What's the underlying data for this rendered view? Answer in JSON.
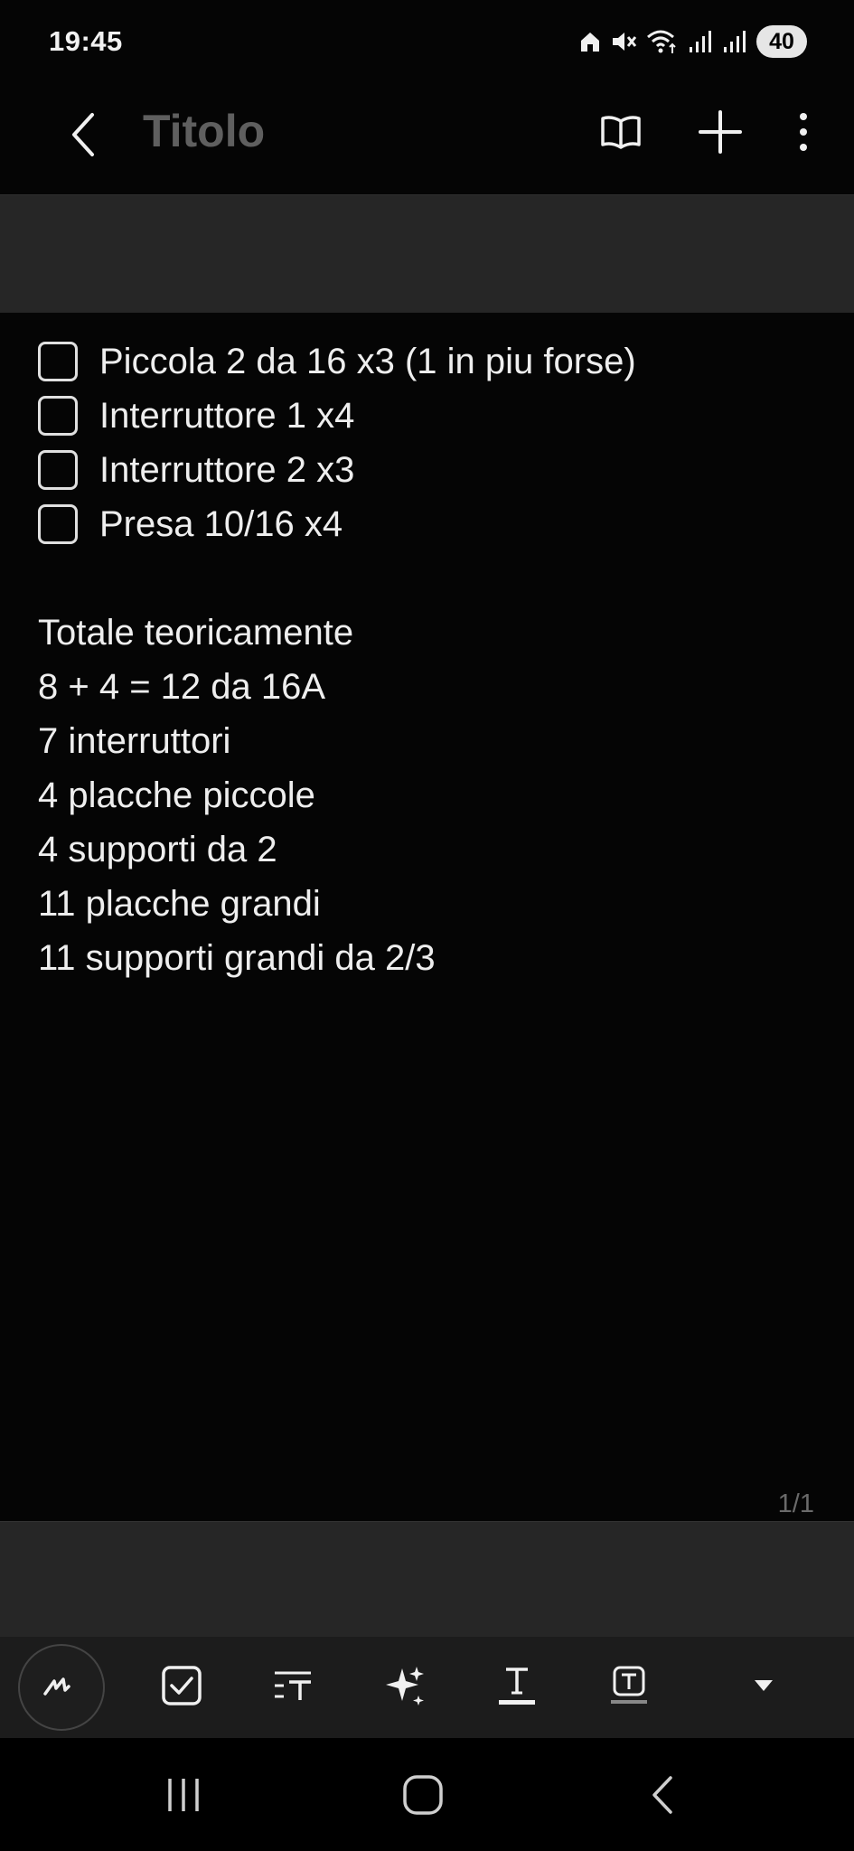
{
  "status_bar": {
    "time": "19:45",
    "battery": "40",
    "icons": [
      "home-icon",
      "mute-icon",
      "wifi-icon",
      "signal-icon",
      "signal-icon"
    ]
  },
  "app_bar": {
    "back_icon": "chevron-left-icon",
    "title": "Titolo",
    "actions": [
      "book-icon",
      "plus-icon",
      "more-vertical-icon"
    ]
  },
  "note": {
    "checklist": [
      {
        "label": "Piccola 2 da 16 x3 (1 in piu forse)",
        "checked": false
      },
      {
        "label": "Interruttore 1 x4",
        "checked": false
      },
      {
        "label": "Interruttore 2 x3",
        "checked": false
      },
      {
        "label": "Presa 10/16 x4",
        "checked": false
      }
    ],
    "lines": [
      "Totale teoricamente",
      "8 + 4 = 12 da 16A",
      "7 interruttori",
      "4 placche piccole",
      "4 supporti da 2",
      "11 placche grandi",
      "11 supporti grandi da 2/3"
    ]
  },
  "page_indicator": "1/1",
  "format_toolbar": [
    "pen-icon",
    "checkbox-icon",
    "text-style-icon",
    "ai-sparkle-icon",
    "text-color-icon",
    "text-highlight-icon",
    "expand-down-icon"
  ],
  "nav_bar": [
    "recents-icon",
    "home-icon",
    "back-icon"
  ],
  "colors": {
    "background": "#050505",
    "band": "#262626",
    "title": "#5f5f5f",
    "text": "#eeeeee"
  }
}
